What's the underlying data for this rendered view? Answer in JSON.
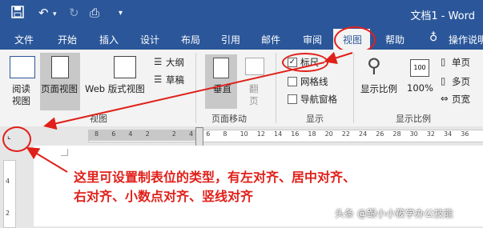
{
  "title_bar": {
    "doc_title": "文档1  -  Word"
  },
  "tabs": [
    "文件",
    "开始",
    "插入",
    "设计",
    "布局",
    "引用",
    "邮件",
    "审阅",
    "视图",
    "帮助"
  ],
  "tell_me": "操作说明",
  "ribbon": {
    "views": {
      "read_l1": "阅读",
      "read_l2": "视图",
      "print": "页面视图",
      "web": "Web 版式视图",
      "outline": "大纲",
      "draft": "草稿",
      "group": "视图"
    },
    "page_move": {
      "vertical": "垂直",
      "side_l1": "翻",
      "side_l2": "页",
      "group": "页面移动"
    },
    "show": {
      "ruler": "标尺",
      "gridlines": "网格线",
      "nav": "导航窗格",
      "group": "显示",
      "ruler_checked": true
    },
    "zoom": {
      "zoom": "显示比例",
      "pct": "100%",
      "one": "单页",
      "multi": "多页",
      "width": "页宽",
      "group": "显示比例"
    }
  },
  "ruler_ticks": [
    "8",
    "6",
    "4",
    "2",
    "2",
    "4",
    "6",
    "8",
    "10",
    "12",
    "14",
    "16",
    "18",
    "20",
    "22",
    "24",
    "26",
    "28",
    "30",
    "32",
    "34",
    "36"
  ],
  "vruler_ticks": [
    "4",
    "2"
  ],
  "annotation": {
    "line1": "这里可设置制表位的类型，有左对齐、居中对齐、",
    "line2": "右对齐、小数点对齐、竖线对齐"
  },
  "watermark": "头条 @跟小小筱学办公技能",
  "colors": {
    "ribbon_blue": "#2b579a",
    "annotation_red": "#e0201a"
  }
}
